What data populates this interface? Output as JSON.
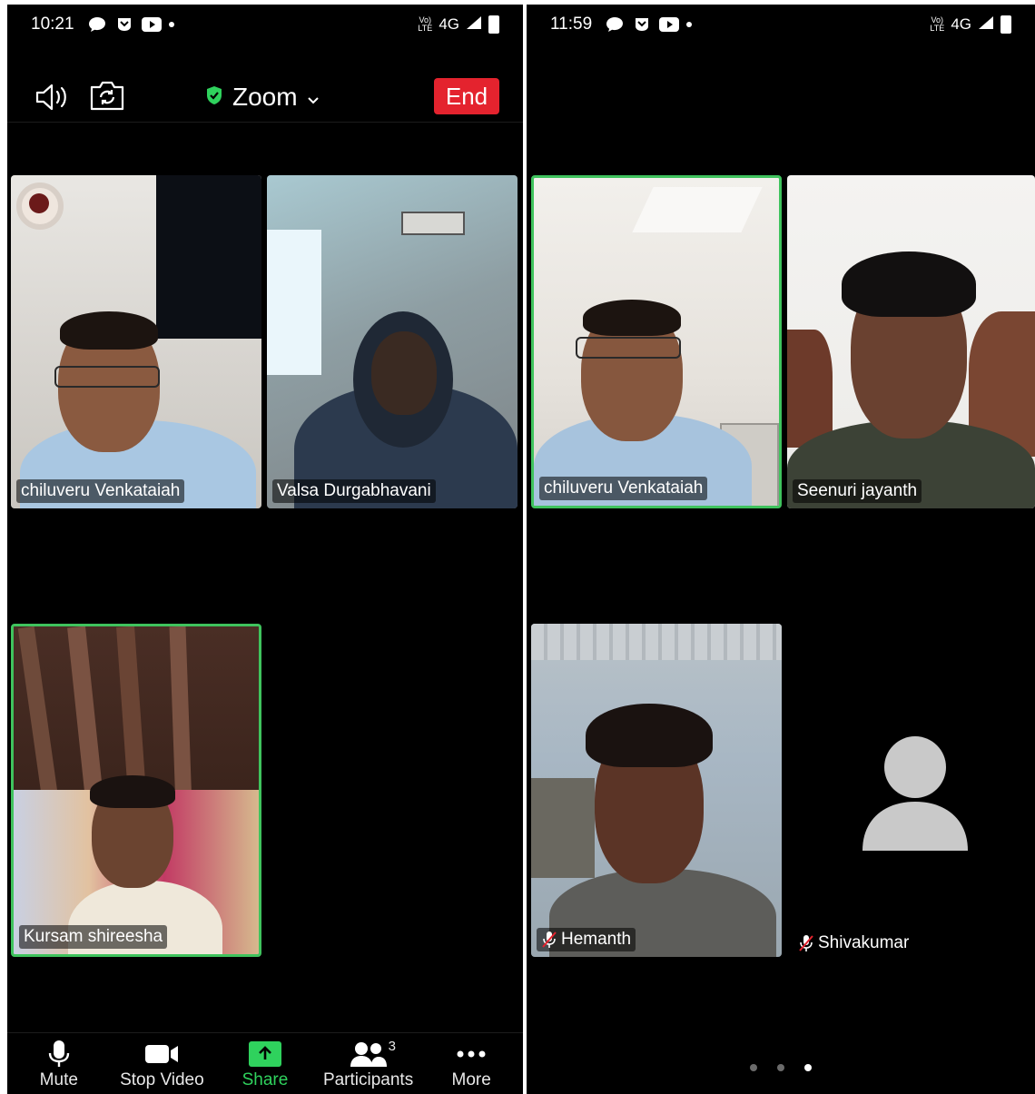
{
  "left": {
    "status": {
      "time": "10:21",
      "network": "4G"
    },
    "meeting_title": "Zoom",
    "end_label": "End",
    "participants": [
      {
        "name": "chiluveru Venkataiah",
        "active": false
      },
      {
        "name": "Valsa Durgabhavani",
        "active": false
      },
      {
        "name": "Kursam shireesha",
        "active": true
      }
    ],
    "toolbar": {
      "mute": "Mute",
      "stop_video": "Stop Video",
      "share": "Share",
      "participants": "Participants",
      "participants_count": "3",
      "more": "More"
    }
  },
  "right": {
    "status": {
      "time": "11:59",
      "network": "4G"
    },
    "participants": [
      {
        "name": "chiluveru Venkataiah",
        "active": true,
        "muted": false
      },
      {
        "name": "Seenuri jayanth",
        "active": false,
        "muted": false
      },
      {
        "name": "Hemanth",
        "active": false,
        "muted": true
      },
      {
        "name": "Shivakumar",
        "active": false,
        "muted": true,
        "video_off": true
      }
    ],
    "page_indicator": {
      "pages": 3,
      "current": 3
    }
  },
  "colors": {
    "end_button": "#e4232e",
    "active_border": "#3fc35d",
    "share_green": "#2fd25d",
    "shield_green": "#2fd25d"
  }
}
